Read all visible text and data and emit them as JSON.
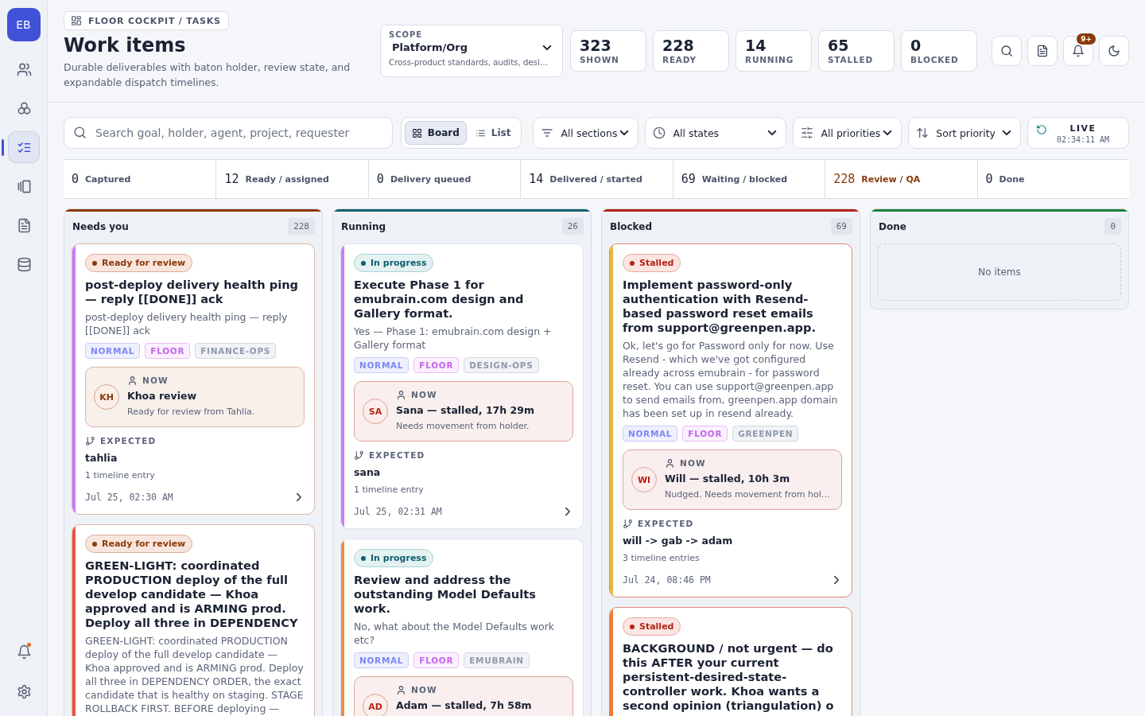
{
  "sidebar": {
    "avatar": "EB",
    "items": [
      {
        "selected": false
      },
      {
        "selected": false
      },
      {
        "selected": true
      },
      {
        "selected": false
      },
      {
        "selected": false
      },
      {
        "selected": false
      }
    ],
    "notifications": {
      "unread": true
    }
  },
  "header": {
    "breadcrumb": "FLOOR COCKPIT / TASKS",
    "title": "Work items",
    "subtitle": "Durable deliverables with baton holder, review state, and expandable dispatch timelines.",
    "scope": {
      "label": "SCOPE",
      "value": "Platform/Org",
      "description": "Cross-product standards, audits, desi…"
    },
    "stats": [
      {
        "value": "323",
        "label": "SHOWN"
      },
      {
        "value": "228",
        "label": "READY"
      },
      {
        "value": "14",
        "label": "RUNNING"
      },
      {
        "value": "65",
        "label": "STALLED"
      },
      {
        "value": "0",
        "label": "BLOCKED"
      }
    ],
    "notification_badge": "9+"
  },
  "toolbar": {
    "search": {
      "placeholder": "Search goal, holder, agent, project, requester"
    },
    "views": [
      {
        "label": "Board",
        "selected": true
      },
      {
        "label": "List",
        "selected": false
      }
    ],
    "filters": [
      "All sections",
      "All states",
      "All priorities",
      "Sort priority"
    ],
    "live": {
      "label": "LIVE",
      "time": "02:34:11 AM"
    }
  },
  "stages": [
    {
      "count": "0",
      "label": "Captured",
      "highlighted": false
    },
    {
      "count": "12",
      "label": "Ready / assigned",
      "highlighted": false
    },
    {
      "count": "0",
      "label": "Delivery queued",
      "highlighted": false
    },
    {
      "count": "14",
      "label": "Delivered / started",
      "highlighted": false
    },
    {
      "count": "69",
      "label": "Waiting / blocked",
      "highlighted": false
    },
    {
      "count": "228",
      "label": "Review / QA",
      "highlighted": true
    },
    {
      "count": "0",
      "label": "Done",
      "highlighted": false
    }
  ],
  "columns": [
    {
      "title": "Needs you",
      "count": "228",
      "color": "#8a3a0a",
      "cards": [
        {
          "color": "#c77dff",
          "status": {
            "kind": "review",
            "label": "Ready for review"
          },
          "title": "post-deploy delivery health ping — reply [[DONE]] ack",
          "description": "post-deploy delivery health ping — reply [[DONE]] ack",
          "tags": [
            {
              "kind": "priority",
              "label": "NORMAL"
            },
            {
              "kind": "section",
              "label": "FLOOR"
            },
            {
              "kind": "project",
              "label": "FINANCE-OPS"
            }
          ],
          "now": {
            "kind": "review",
            "initials": "KH",
            "label": "NOW",
            "name": "Khoa review",
            "note": "Ready for review from Tahlia."
          },
          "expected": {
            "label": "EXPECTED",
            "value": "tahlia"
          },
          "timeline": "1 timeline entry",
          "date": "Jul 25, 02:30 AM"
        },
        {
          "color": "#e4573d",
          "status": {
            "kind": "review",
            "label": "Ready for review"
          },
          "title": "GREEN-LIGHT: coordinated PRODUCTION deploy of the full develop candidate — Khoa approved and is ARMING prod. Deploy all three in DEPENDENCY",
          "description": "GREEN-LIGHT: coordinated PRODUCTION deploy of the full develop candidate — Khoa approved and is ARMING prod. Deploy all three in DEPENDENCY ORDER, the exact candidate that is healthy on staging. STAGE ROLLBACK FIRST. BEFORE deploying —"
        }
      ]
    },
    {
      "title": "Running",
      "count": "26",
      "color": "#11606b",
      "cards": [
        {
          "color": "#c77dff",
          "status": {
            "kind": "progress",
            "label": "In progress"
          },
          "title": "Execute Phase 1 for emubrain.com design and Gallery format.",
          "description": "Yes — Phase 1: emubrain.com design + Gallery format",
          "tags": [
            {
              "kind": "priority",
              "label": "NORMAL"
            },
            {
              "kind": "section",
              "label": "FLOOR"
            },
            {
              "kind": "project",
              "label": "DESIGN-OPS"
            }
          ],
          "now": {
            "kind": "stalled",
            "initials": "SA",
            "label": "NOW",
            "name": "Sana — stalled, 17h 29m",
            "note": "Needs movement from holder."
          },
          "expected": {
            "label": "EXPECTED",
            "value": "sana"
          },
          "timeline": "1 timeline entry",
          "date": "Jul 25, 02:31 AM"
        },
        {
          "color": "#ef8a45",
          "status": {
            "kind": "progress",
            "label": "In progress"
          },
          "title": "Review and address the outstanding Model Defaults work.",
          "description": "No, what about the Model Defaults work etc?",
          "tags": [
            {
              "kind": "priority",
              "label": "NORMAL"
            },
            {
              "kind": "section",
              "label": "FLOOR"
            },
            {
              "kind": "project",
              "label": "EMUBRAIN"
            }
          ],
          "now": {
            "kind": "stalled",
            "initials": "AD",
            "label": "NOW",
            "name": "Adam — stalled, 7h 58m"
          }
        }
      ]
    },
    {
      "title": "Blocked",
      "count": "69",
      "color": "#b42318",
      "cards": [
        {
          "color": "#e8b73a",
          "status": {
            "kind": "stalled",
            "label": "Stalled"
          },
          "title": "Implement password-only authentication with Resend-based password reset emails from support@greenpen.app.",
          "description": "Ok, let's go for Password only for now. Use Resend - which we've got configured already across emubrain - for password reset. You can use support@greenpen.app to send emails from, greenpen.app domain has been set up in resend already.",
          "tags": [
            {
              "kind": "priority",
              "label": "NORMAL"
            },
            {
              "kind": "section",
              "label": "FLOOR"
            },
            {
              "kind": "project",
              "label": "GREENPEN"
            }
          ],
          "now": {
            "kind": "stalled",
            "initials": "WI",
            "label": "NOW",
            "name": "Will — stalled, 10h 3m",
            "note": "Nudged. Needs movement from hol…"
          },
          "expected": {
            "label": "EXPECTED",
            "value": "will -> gab -> adam"
          },
          "timeline": "3 timeline entries",
          "date": "Jul 24, 08:46 PM"
        },
        {
          "color": "#ef7b35",
          "status": {
            "kind": "stalled",
            "label": "Stalled"
          },
          "title": "BACKGROUND / not urgent — do this AFTER your current persistent-desired-state-controller work. Khoa wants a second opinion (triangulation) o"
        }
      ]
    },
    {
      "title": "Done",
      "count": "0",
      "color": "#1a7f37",
      "empty_text": "No items"
    }
  ]
}
